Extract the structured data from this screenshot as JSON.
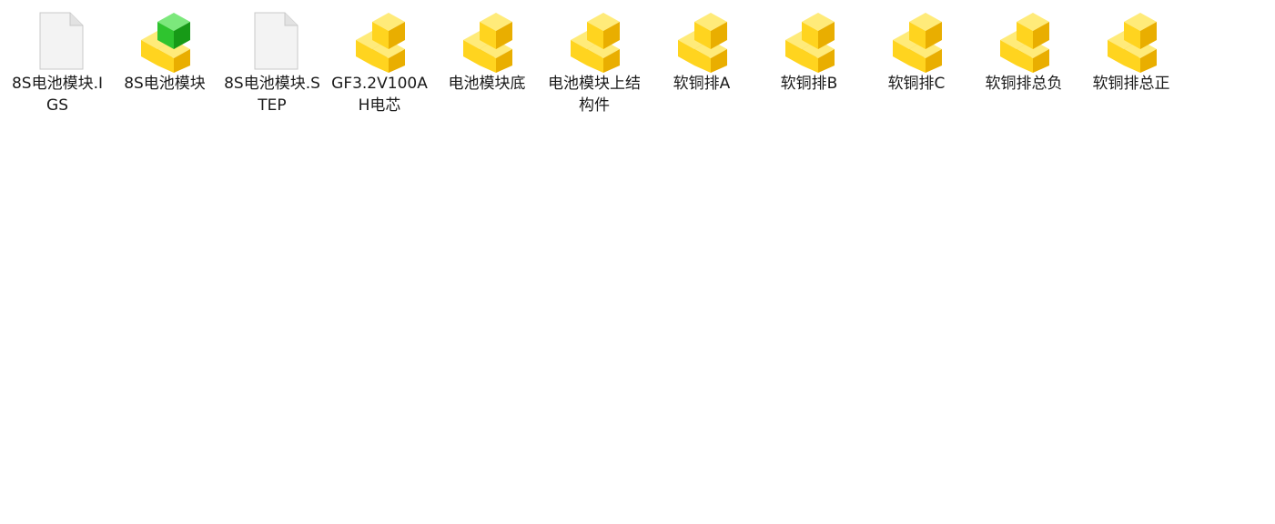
{
  "files": [
    {
      "label": "8S电池模块.IGS",
      "icon": "generic-document-icon"
    },
    {
      "label": "8S电池模块",
      "icon": "assembly-part-icon"
    },
    {
      "label": "8S电池模块.STEP",
      "icon": "generic-document-icon"
    },
    {
      "label": "GF3.2V100AH电芯",
      "icon": "part-file-icon"
    },
    {
      "label": "电池模块底",
      "icon": "part-file-icon"
    },
    {
      "label": "电池模块上结构件",
      "icon": "part-file-icon"
    },
    {
      "label": "软铜排A",
      "icon": "part-file-icon"
    },
    {
      "label": "软铜排B",
      "icon": "part-file-icon"
    },
    {
      "label": "软铜排C",
      "icon": "part-file-icon"
    },
    {
      "label": "软铜排总负",
      "icon": "part-file-icon"
    },
    {
      "label": "软铜排总正",
      "icon": "part-file-icon"
    }
  ],
  "colors": {
    "part_yellow_light": "#FFE873",
    "part_yellow": "#FFD21A",
    "part_yellow_dark": "#E6A800",
    "assembly_green": "#2FC42F",
    "document_gray": "#F1F1F1"
  }
}
